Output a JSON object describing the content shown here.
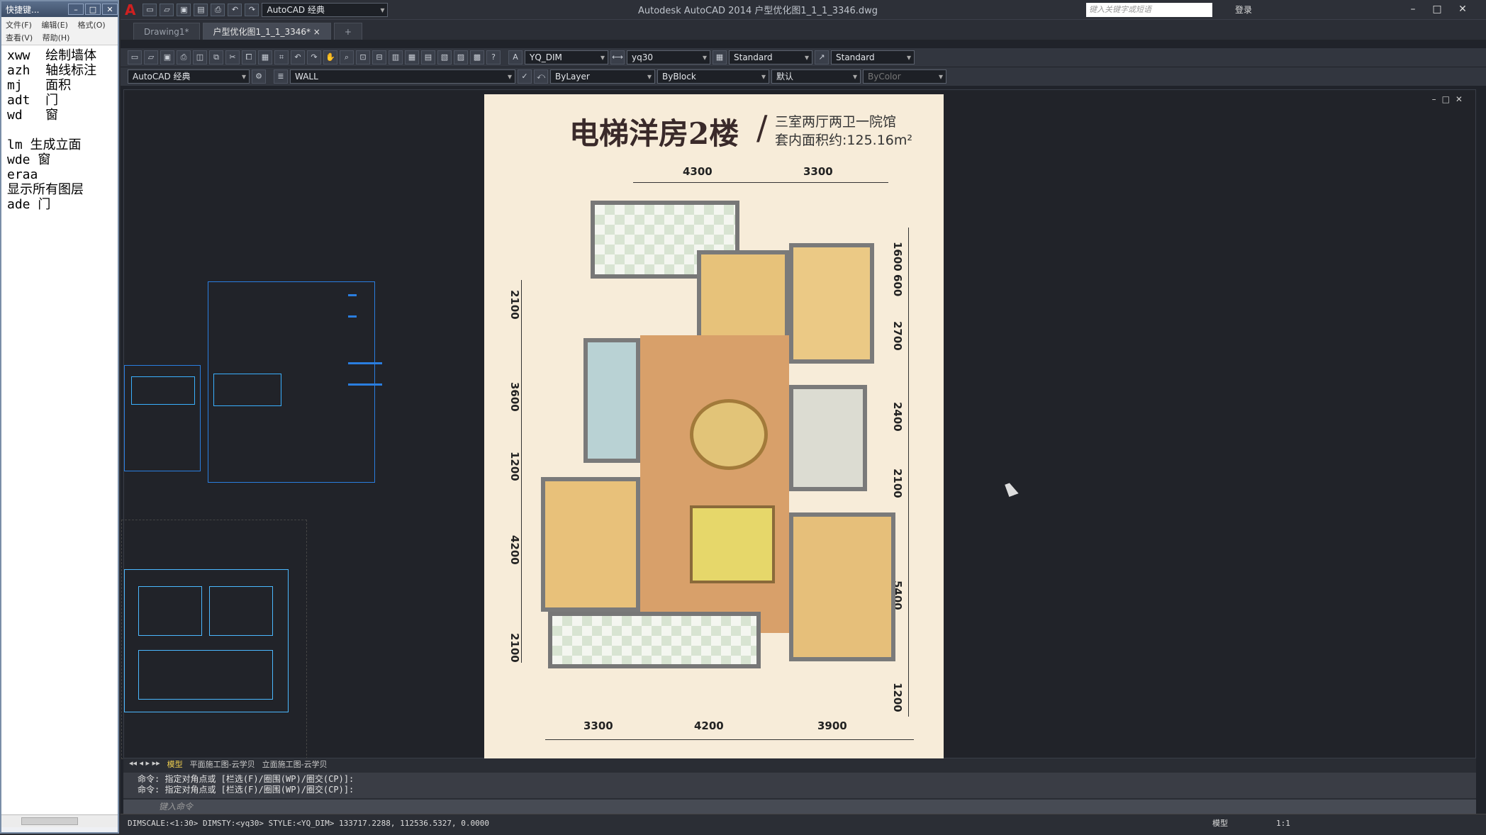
{
  "notepad": {
    "title": "快捷键...",
    "menu_row1": [
      "文件(F)",
      "编辑(E)",
      "格式(O)"
    ],
    "menu_row2": [
      "查看(V)",
      "帮助(H)"
    ],
    "lines": [
      "xww  绘制墙体",
      "azh  轴线标注",
      "mj   面积",
      "adt  门",
      "wd   窗",
      "",
      "lm 生成立面",
      "wde 窗",
      "eraa",
      "显示所有图层",
      "ade 门"
    ]
  },
  "app": {
    "workspace": "AutoCAD 经典",
    "title": "Autodesk AutoCAD 2014    户型优化图1_1_1_3346.dwg",
    "search_placeholder": "键入关键字或短语",
    "login": "登录"
  },
  "doc_tabs": [
    "Drawing1*",
    "户型优化图1_1_1_3346* ×"
  ],
  "toolbar": {
    "dimstyle": "YQ_DIM",
    "textstyle": "yq30",
    "tablestyle": "Standard",
    "mleaderstyle": "Standard",
    "workspace2": "AutoCAD 经典",
    "layer": "WALL",
    "color": "ByLayer",
    "linetype": "ByBlock",
    "lineweight": "默认",
    "plotstyle": "ByColor"
  },
  "plan": {
    "title": "电梯洋房2楼",
    "sub1": "三室两厅两卫一院馆",
    "sub2": "套内面积约:125.16m²",
    "top_dims": [
      "4300",
      "3300"
    ],
    "bottom_dims": [
      "3300",
      "4200",
      "3900"
    ],
    "left_dims": [
      "2100",
      "3600",
      "1200",
      "4200",
      "2100"
    ],
    "right_dims": [
      "1600",
      "600",
      "2700",
      "2400",
      "2100",
      "5400",
      "1200"
    ]
  },
  "layout_tabs": [
    "模型",
    "平面施工图-云学贝",
    "立面施工图-云学贝"
  ],
  "command": {
    "history": [
      "命令: 指定对角点或 [栏选(F)/圈围(WP)/圈交(CP)]:",
      "命令: 指定对角点或 [栏选(F)/圈围(WP)/圈交(CP)]:"
    ],
    "input_placeholder": "键入命令"
  },
  "status": {
    "text": "DIMSCALE:<1:30> DIMSTY:<yq30> STYLE:<YQ_DIM>   133717.2288, 112536.5327, 0.0000",
    "model": "模型",
    "scale": "1:1"
  }
}
